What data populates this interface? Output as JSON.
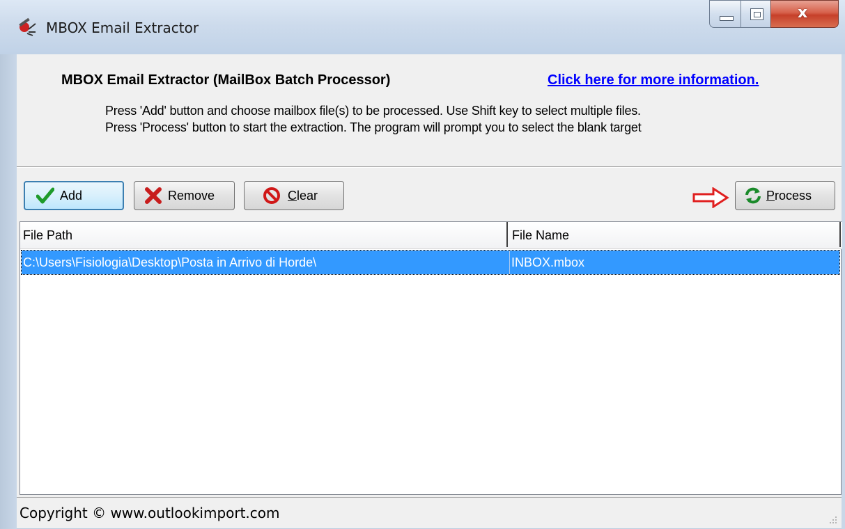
{
  "window": {
    "title": "MBOX Email Extractor",
    "icon": "app-icon",
    "controls": {
      "minimize": "minimize-icon",
      "maximize": "maximize-icon",
      "close": "x"
    }
  },
  "header": {
    "title": "MBOX Email Extractor (MailBox Batch Processor)",
    "link": "Click here for more information.",
    "line1": "Press 'Add' button and choose mailbox file(s) to be processed. Use Shift key to select multiple files.",
    "line2": "Press 'Process' button to start the extraction. The program will prompt you to select the blank target"
  },
  "toolbar": {
    "add": {
      "prefix": "",
      "accel": "",
      "rest": "Add",
      "icon": "checkmark-icon"
    },
    "remove": {
      "label": "Remove",
      "icon": "x-icon"
    },
    "clear": {
      "accel": "C",
      "rest": "lear",
      "icon": "no-sign-icon"
    },
    "process": {
      "accel": "P",
      "rest": "rocess",
      "icon": "refresh-icon"
    },
    "pointer_icon": "red-arrow-icon"
  },
  "list": {
    "columns": [
      "File Path",
      "File Name"
    ],
    "rows": [
      {
        "path": "C:\\Users\\Fisiologia\\Desktop\\Posta in Arrivo di Horde\\",
        "name": "INBOX.mbox",
        "selected": true
      }
    ]
  },
  "status": {
    "text": "Copyright © www.outlookimport.com"
  },
  "colors": {
    "selection": "#3399ff",
    "link": "#0000ff",
    "arrow": "#e02020"
  }
}
